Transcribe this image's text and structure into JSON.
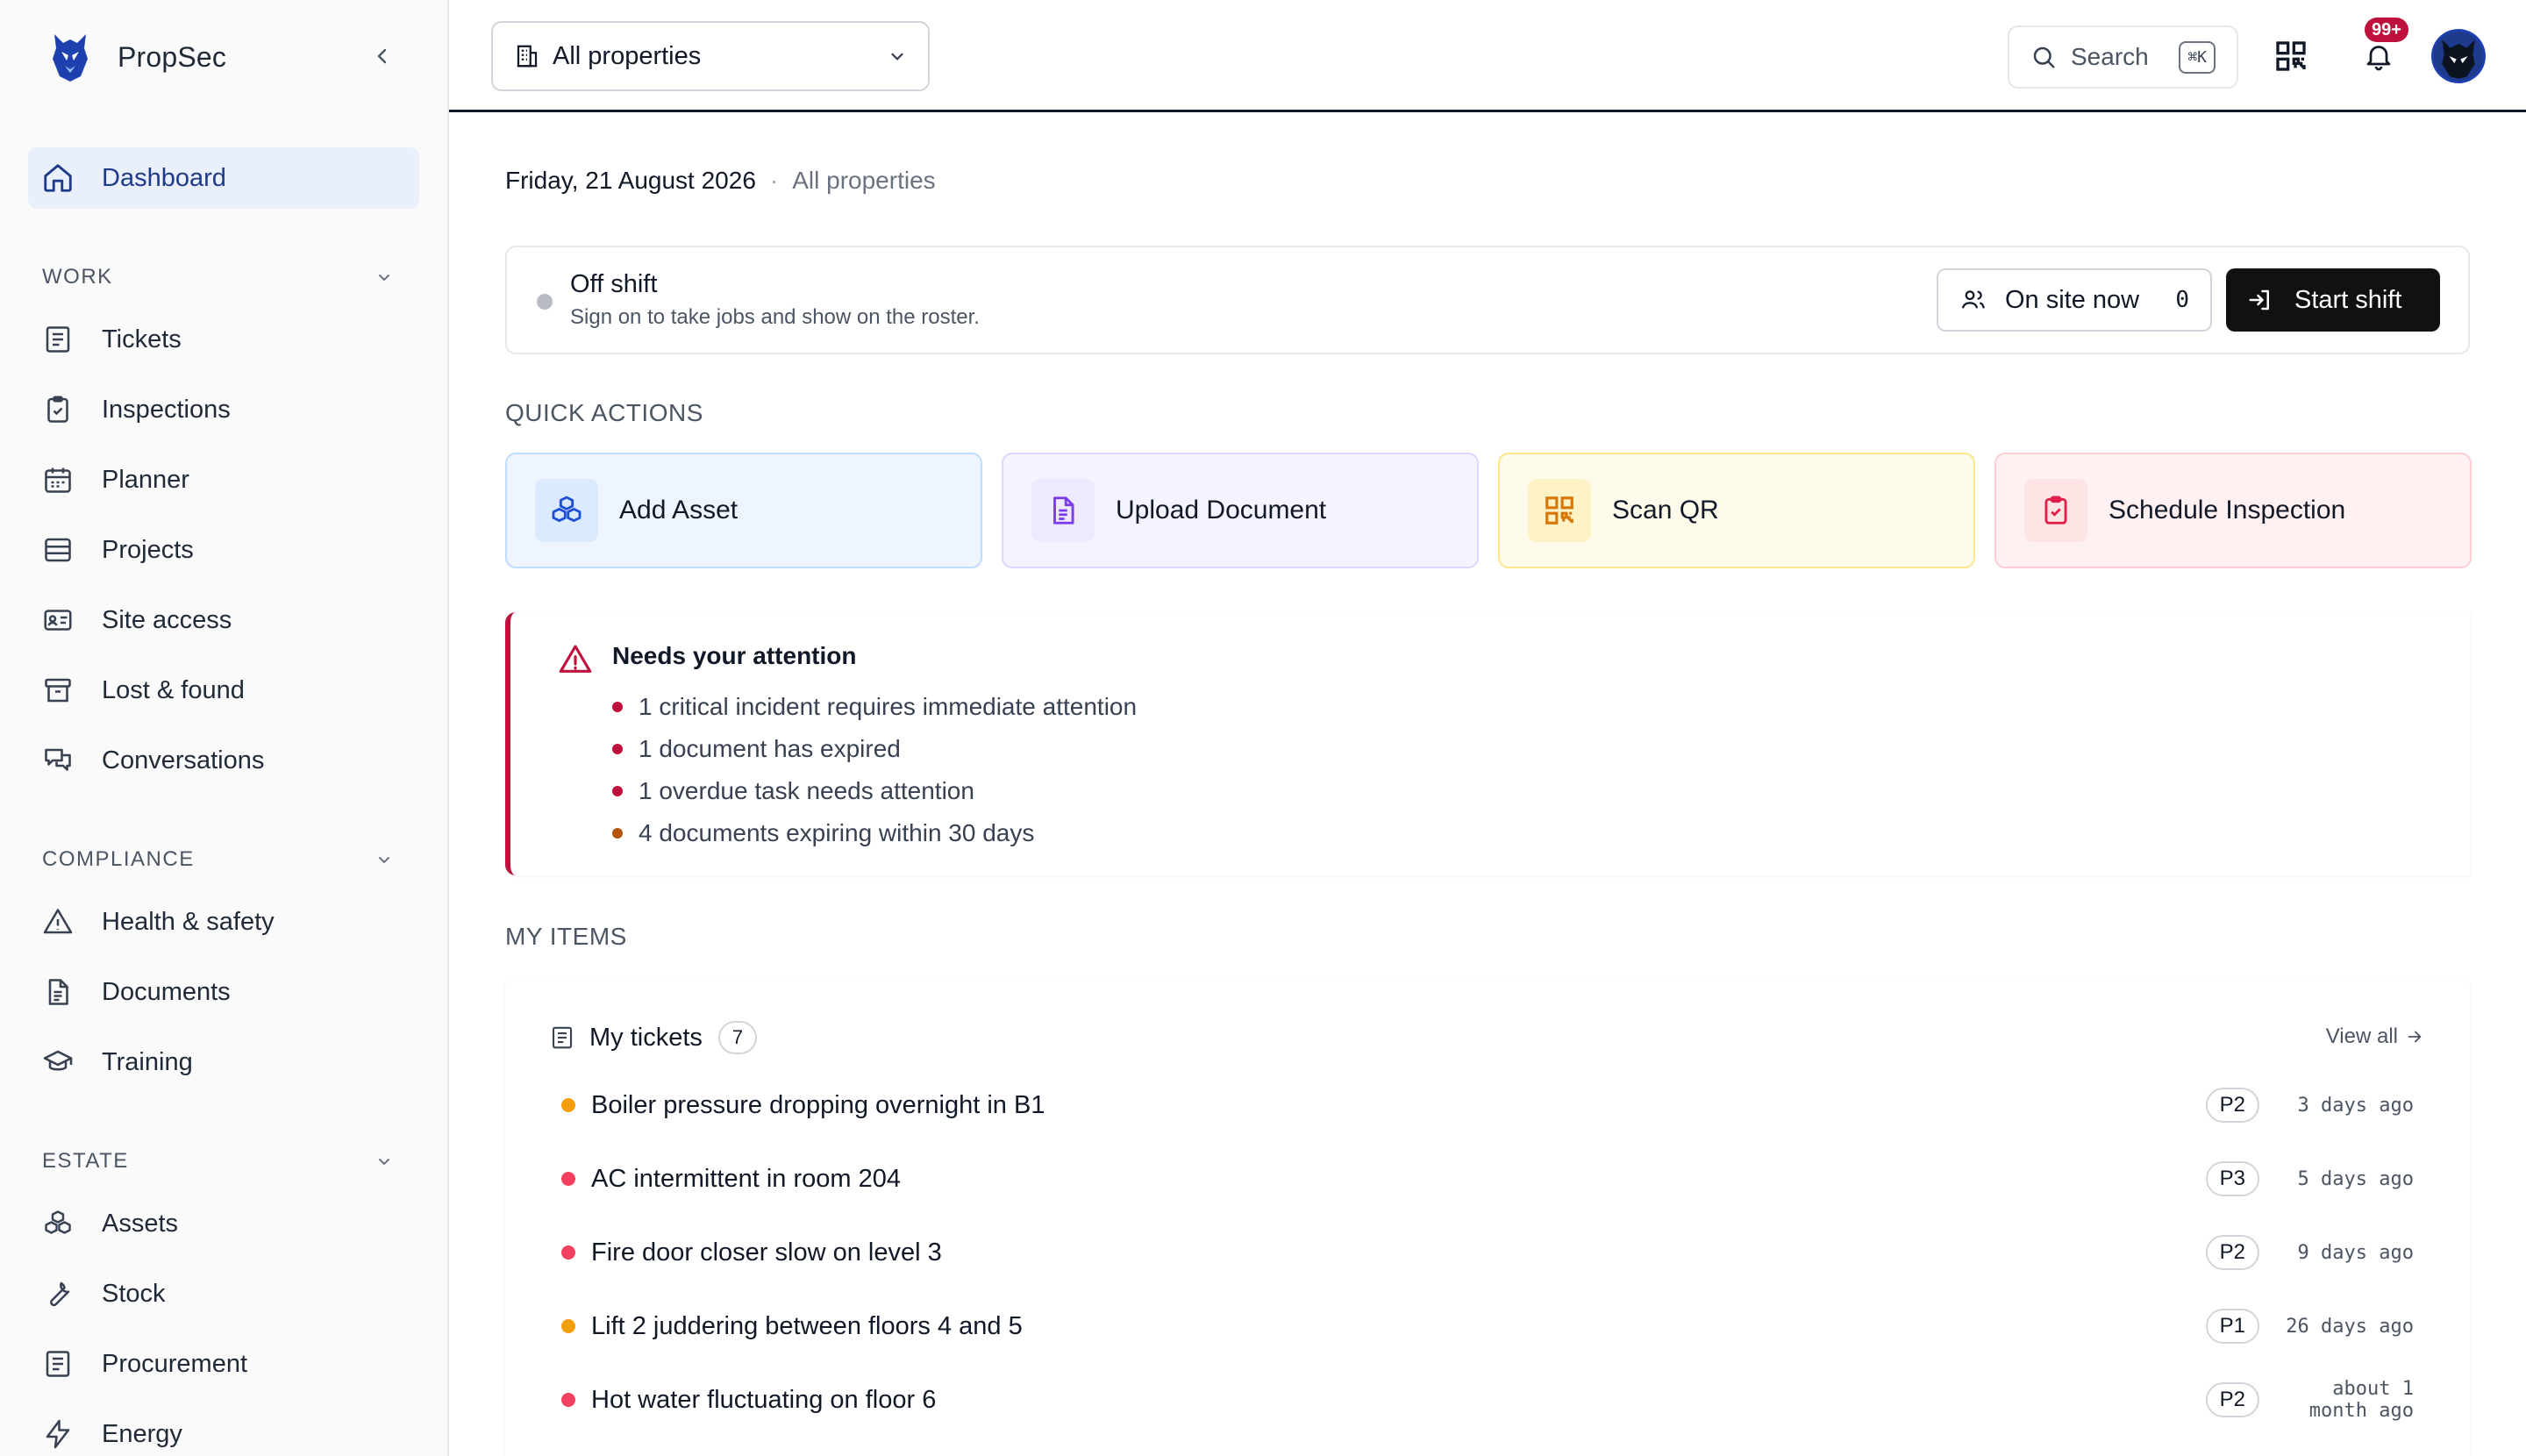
{
  "brand": {
    "name": "PropSec"
  },
  "sidebar": {
    "dashboard": "Dashboard",
    "sections": [
      {
        "title": "WORK",
        "items": [
          "Tickets",
          "Inspections",
          "Planner",
          "Projects",
          "Site access",
          "Lost & found",
          "Conversations"
        ]
      },
      {
        "title": "COMPLIANCE",
        "items": [
          "Health & safety",
          "Documents",
          "Training"
        ]
      },
      {
        "title": "ESTATE",
        "items": [
          "Assets",
          "Stock",
          "Procurement",
          "Energy"
        ]
      }
    ]
  },
  "topbar": {
    "property_selector": "All properties",
    "search_label": "Search",
    "search_shortcut": "⌘K",
    "notification_count": "99+"
  },
  "main": {
    "date": "Friday, 21 August 2026",
    "date_separator": "·",
    "scope": "All properties",
    "shift": {
      "status": "Off shift",
      "description": "Sign on to take jobs and show on the roster.",
      "on_site_label": "On site now",
      "on_site_count": "0",
      "start_label": "Start shift"
    },
    "quick_actions_title": "QUICK ACTIONS",
    "quick_actions": [
      {
        "label": "Add Asset",
        "icon": "boxes-icon",
        "bg": "#eef5ff",
        "border": "#bfdbfe",
        "icon_bg": "#dbeafe",
        "icon_color": "#1d4ed8"
      },
      {
        "label": "Upload Document",
        "icon": "document-icon",
        "bg": "#f5f3ff",
        "border": "#ddd6fe",
        "icon_bg": "#ede9fe",
        "icon_color": "#7c3aed"
      },
      {
        "label": "Scan QR",
        "icon": "qr-icon",
        "bg": "#fffbeb",
        "border": "#fde68a",
        "icon_bg": "#fef3c7",
        "icon_color": "#d97706"
      },
      {
        "label": "Schedule Inspection",
        "icon": "clipboard-check-icon",
        "bg": "#fff1f2",
        "border": "#fecdd3",
        "icon_bg": "#ffe4e6",
        "icon_color": "#e11d48"
      }
    ],
    "attention": {
      "title": "Needs your attention",
      "items": [
        {
          "text": "1 critical incident requires immediate attention",
          "color": "#be123c"
        },
        {
          "text": "1 document has expired",
          "color": "#be123c"
        },
        {
          "text": "1 overdue task needs attention",
          "color": "#be123c"
        },
        {
          "text": "4 documents expiring within 30 days",
          "color": "#b45309"
        }
      ]
    },
    "my_items_title": "MY ITEMS",
    "tickets": {
      "title": "My tickets",
      "count": "7",
      "view_all": "View all",
      "rows": [
        {
          "title": "Boiler pressure dropping overnight in B1",
          "priority": "P2",
          "age": "3 days ago",
          "dot": "#f59e0b"
        },
        {
          "title": "AC intermittent in room 204",
          "priority": "P3",
          "age": "5 days ago",
          "dot": "#f43f5e"
        },
        {
          "title": "Fire door closer slow on level 3",
          "priority": "P2",
          "age": "9 days ago",
          "dot": "#f43f5e"
        },
        {
          "title": "Lift 2 juddering between floors 4 and 5",
          "priority": "P1",
          "age": "26 days ago",
          "dot": "#f59e0b"
        },
        {
          "title": "Hot water fluctuating on floor 6",
          "priority": "P2",
          "age": "about 1 month ago",
          "dot": "#f43f5e"
        }
      ]
    }
  }
}
